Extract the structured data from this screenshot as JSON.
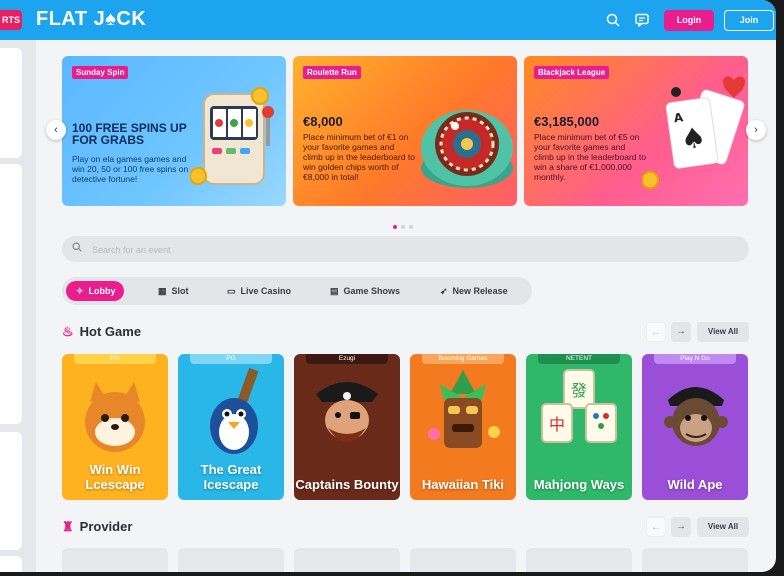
{
  "header": {
    "sports_tab": "RTS",
    "logo": "FLAT J♠CK",
    "login": "Login",
    "join": "Join"
  },
  "banners": [
    {
      "tag": "Sunday Spin",
      "title": "100 FREE SPINS UP FOR GRABS",
      "desc": "Play on ela games games and win 20, 50 or 100 free spins on detective fortune!"
    },
    {
      "tag": "Roulette Run",
      "amount": "€8,000",
      "desc": "Place minimum bet of €1 on your favorite games and climb up in the leaderboard to win golden chips worth of €8,000 in total!"
    },
    {
      "tag": "Blackjack League",
      "amount": "€3,185,000",
      "desc": "Place minimum bet of €5 on your favorite games and climb up in the leaderboard to win a share of €1,000,000 monthly."
    }
  ],
  "search": {
    "placeholder": "Search for an event"
  },
  "tabs": [
    {
      "label": "Lobby",
      "icon": "sparkle-icon"
    },
    {
      "label": "Slot",
      "icon": "slot-machine-icon"
    },
    {
      "label": "Live Casino",
      "icon": "tv-icon"
    },
    {
      "label": "Game Shows",
      "icon": "monitor-icon"
    },
    {
      "label": "New Release",
      "icon": "rocket-icon"
    }
  ],
  "hot_game": {
    "title": "Hot Game",
    "view_all": "View All",
    "games": [
      {
        "provider": "PG",
        "name": "Win Win Lcescape",
        "color": "#ffb21f"
      },
      {
        "provider": "PG",
        "name": "The Great Icescape",
        "color": "#28b7e6"
      },
      {
        "provider": "Ezugi",
        "name": "Captains Bounty",
        "color": "#6a2a1a"
      },
      {
        "provider": "Booming Games",
        "name": "Hawaiian Tiki",
        "color": "#f37a1f"
      },
      {
        "provider": "NETENT",
        "name": "Mahjong Ways",
        "color": "#2fb86a"
      },
      {
        "provider": "Play N Go",
        "name": "Wild Ape",
        "color": "#9b4fd8"
      }
    ]
  },
  "provider_section": {
    "title": "Provider",
    "view_all": "View All"
  },
  "colors": {
    "brand_blue": "#1ca5ee",
    "accent_pink": "#e91e8c"
  }
}
